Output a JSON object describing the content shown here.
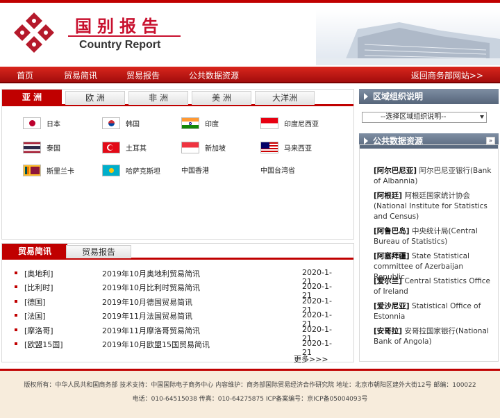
{
  "header": {
    "title_cn": "国别报告",
    "title_en": "Country Report"
  },
  "nav": {
    "items": [
      "首页",
      "贸易简讯",
      "贸易报告",
      "公共数据资源"
    ],
    "back": "返回商务部网站>>"
  },
  "regions": {
    "tabs": [
      "亚 洲",
      "欧 洲",
      "非 洲",
      "美 洲",
      "大洋洲"
    ],
    "countries": [
      {
        "name": "日本",
        "flag": "japan-flag"
      },
      {
        "name": "韩国",
        "flag": "korea-flag"
      },
      {
        "name": "印度",
        "flag": "india-flag"
      },
      {
        "name": "印度尼西亚",
        "flag": "indonesia-flag"
      },
      {
        "name": "泰国",
        "flag": "thailand-flag"
      },
      {
        "name": "土耳其",
        "flag": "turkey-flag"
      },
      {
        "name": "新加坡",
        "flag": "singapore-flag"
      },
      {
        "name": "马来西亚",
        "flag": "malaysia-flag"
      },
      {
        "name": "斯里兰卡",
        "flag": "srilanka-flag"
      },
      {
        "name": "哈萨克斯坦",
        "flag": "kazakhstan-flag"
      },
      {
        "name": "中国香港",
        "flag": ""
      },
      {
        "name": "中国台湾省",
        "flag": ""
      }
    ]
  },
  "news": {
    "tabs": [
      "贸易简讯",
      "贸易报告"
    ],
    "items": [
      {
        "region": "[奥地利]",
        "title": "2019年10月奥地利贸易简讯",
        "date": "2020-1-21"
      },
      {
        "region": "[比利时]",
        "title": "2019年10月比利时贸易简讯",
        "date": "2020-1-21"
      },
      {
        "region": "[德国]",
        "title": "2019年10月德国贸易简讯",
        "date": "2020-1-21"
      },
      {
        "region": "[法国]",
        "title": "2019年11月法国贸易简讯",
        "date": "2020-1-21"
      },
      {
        "region": "[摩洛哥]",
        "title": "2019年11月摩洛哥贸易简讯",
        "date": "2020-1-21"
      },
      {
        "region": "[欧盟15国]",
        "title": "2019年10月欧盟15国贸易简讯",
        "date": "2020-1-21"
      }
    ],
    "more": "更多>>>"
  },
  "sidebar": {
    "org_title": "区域组织说明",
    "select_placeholder": "--选择区域组织说明--",
    "res_title": "公共数据资源",
    "resources": [
      {
        "tag": "[阿尔巴尼亚]",
        "text": "阿尔巴尼亚银行(Bank of Albannia)"
      },
      {
        "tag": "[阿根廷]",
        "text": "阿根廷国家统计协会(National Institute for Statistics and Census)"
      },
      {
        "tag": "[阿鲁巴岛]",
        "text": "中央统计局(Central Bureau of Statistics)"
      },
      {
        "tag": "[阿塞拜疆]",
        "text": "State Statistical committee of Azerbaijan Republic"
      },
      {
        "tag": "[爱尔兰]",
        "text": "Central Statistics Office of Ireland"
      },
      {
        "tag": "[爱沙尼亚]",
        "text": "Statistical Office of Estonnia"
      },
      {
        "tag": "[安哥拉]",
        "text": "安哥拉国家银行(National Bank of Angola)"
      }
    ]
  },
  "footer": {
    "line1": "版权所有：中华人民共和国商务部 技术支持：中国国际电子商务中心 内容维护：商务部国际贸易经济合作研究院 地址：北京市朝阳区建外大街12号 邮编：100022",
    "line2": "电话：010-64515038 传真：010-64275875 ICP备案编号：京ICP备05004093号"
  }
}
